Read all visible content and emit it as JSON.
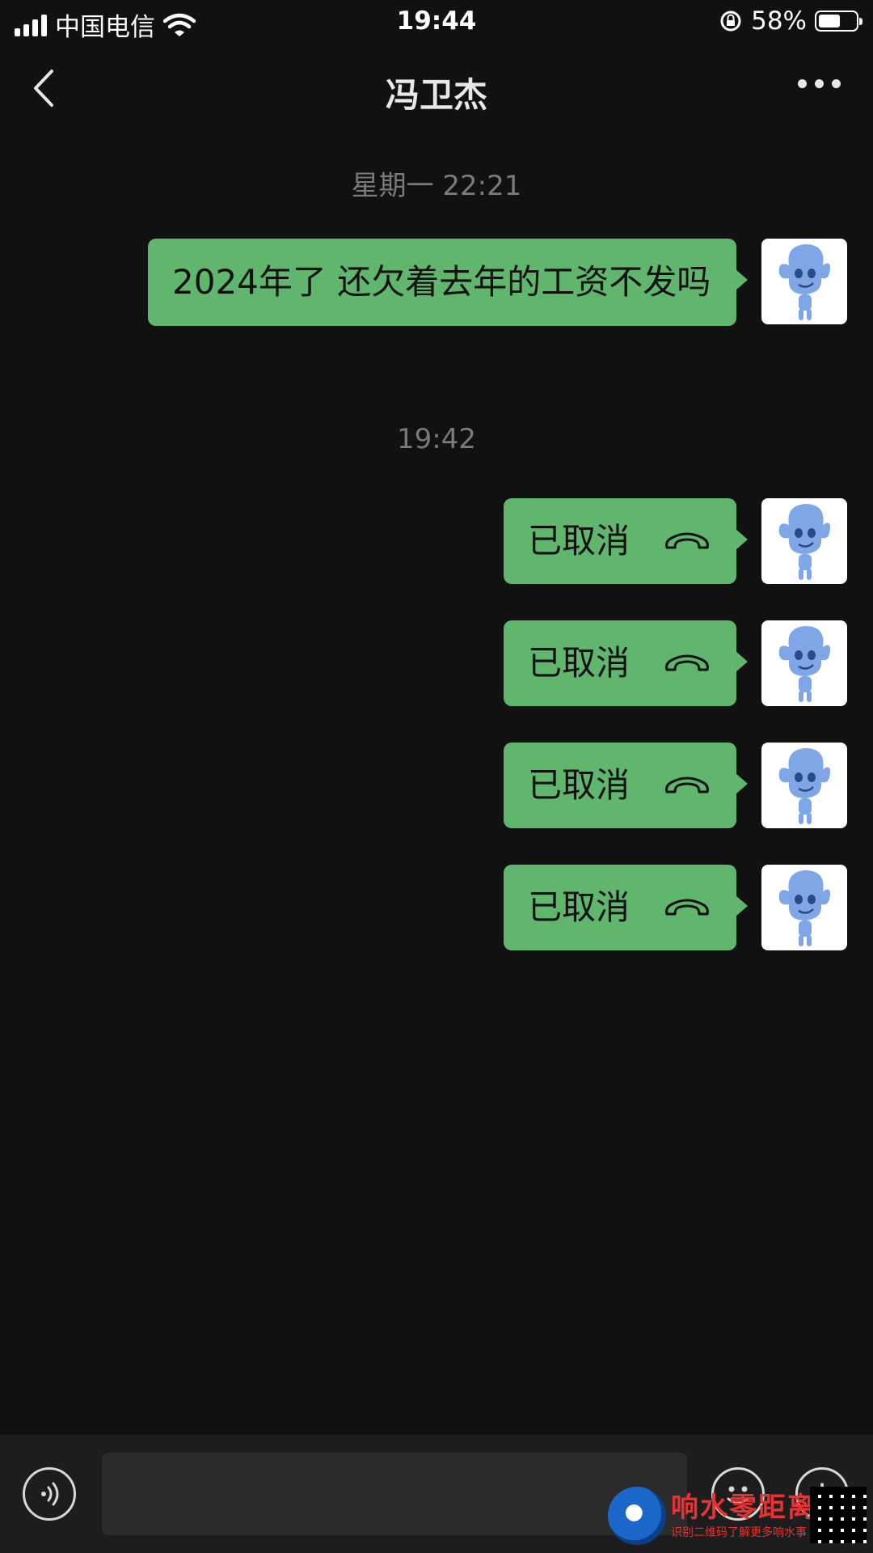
{
  "status_bar": {
    "carrier": "中国电信",
    "time": "19:44",
    "battery_percent": "58%",
    "battery_level": 0.58
  },
  "nav": {
    "title": "冯卫杰",
    "back_icon": "chevron-left-icon",
    "more_icon": "more-dots-icon"
  },
  "chat": {
    "timestamps": [
      "星期一 22:21",
      "19:42"
    ],
    "messages": [
      {
        "type": "text",
        "text": "2024年了 还欠着去年的工资不发吗"
      },
      {
        "type": "call",
        "text": "已取消"
      },
      {
        "type": "call",
        "text": "已取消"
      },
      {
        "type": "call",
        "text": "已取消"
      },
      {
        "type": "call",
        "text": "已取消"
      }
    ]
  },
  "input_bar": {
    "placeholder": "",
    "voice_icon": "voice-icon",
    "emoji_icon": "emoji-icon",
    "plus_icon": "plus-icon"
  },
  "watermark": {
    "title": "响水零距离",
    "subtitle": "识别二维码了解更多响水事"
  },
  "colors": {
    "background": "#111111",
    "bubble": "#5fb66c",
    "input_bar": "#1d1d1d"
  }
}
